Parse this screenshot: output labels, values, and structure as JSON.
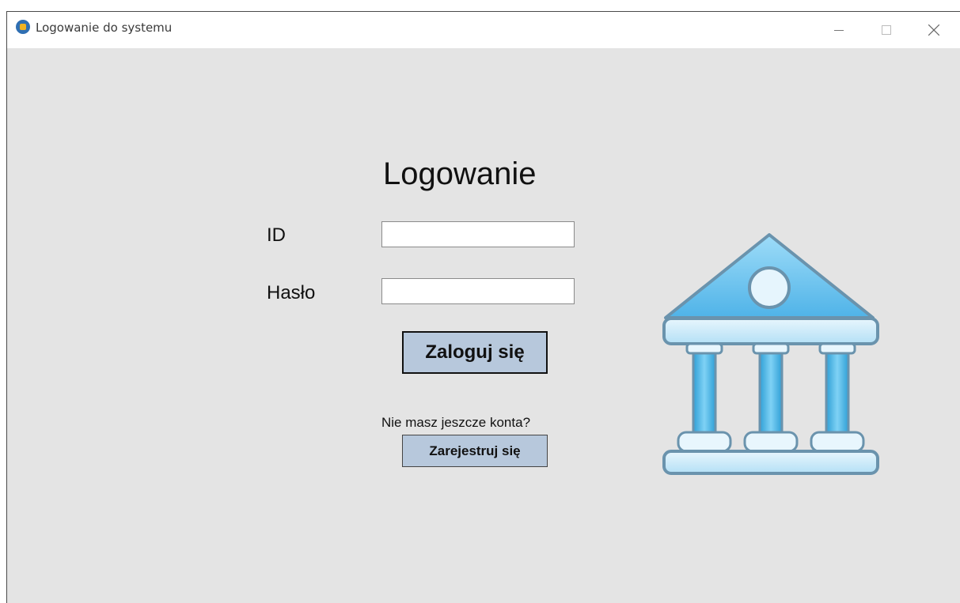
{
  "window": {
    "title": "Logowanie do systemu"
  },
  "form": {
    "heading": "Logowanie",
    "id_label": "ID",
    "id_value": "",
    "password_label": "Hasło",
    "password_value": "",
    "login_button": "Zaloguj się",
    "register_prompt": "Nie masz jeszcze konta?",
    "register_button": "Zarejestruj się"
  },
  "icons": {
    "app": "app-icon",
    "illustration": "bank-building-icon"
  },
  "colors": {
    "background": "#e4e4e4",
    "button": "#b7c8dc",
    "bank_fill": "#5ab8ea"
  }
}
